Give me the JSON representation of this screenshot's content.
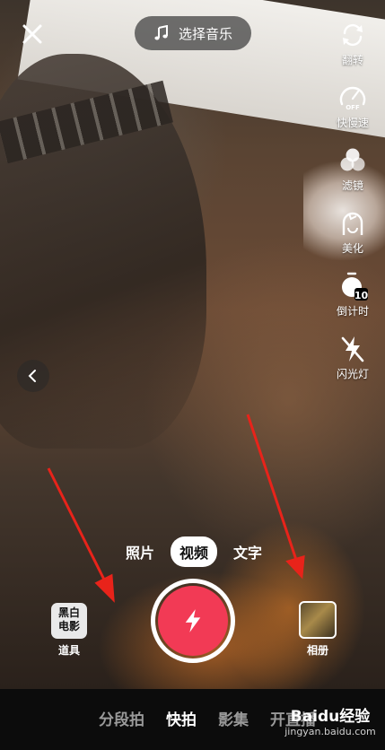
{
  "top_bar": {
    "music_label": "选择音乐"
  },
  "right_tools": [
    {
      "label": "翻转",
      "icon": "flip-camera-icon"
    },
    {
      "label": "快慢速",
      "icon": "speed-icon",
      "badge": "OFF"
    },
    {
      "label": "滤镜",
      "icon": "filter-icon"
    },
    {
      "label": "美化",
      "icon": "beautify-icon"
    },
    {
      "label": "倒计时",
      "icon": "countdown-icon",
      "badge": "10"
    },
    {
      "label": "闪光灯",
      "icon": "flash-off-icon"
    }
  ],
  "modes": [
    "照片",
    "视频",
    "文字"
  ],
  "active_mode": "视频",
  "props": {
    "thumb_line1": "黑白",
    "thumb_line2": "电影",
    "label": "道具"
  },
  "album": {
    "label": "相册"
  },
  "bottom_tabs": [
    "分段拍",
    "快拍",
    "影集",
    "开直播"
  ],
  "active_tab": "快拍",
  "watermark": {
    "brand": "Baidu经验",
    "url": "jingyan.baidu.com"
  },
  "colors": {
    "shutter": "#f23a55",
    "annotation_arrow": "#e8231a"
  }
}
